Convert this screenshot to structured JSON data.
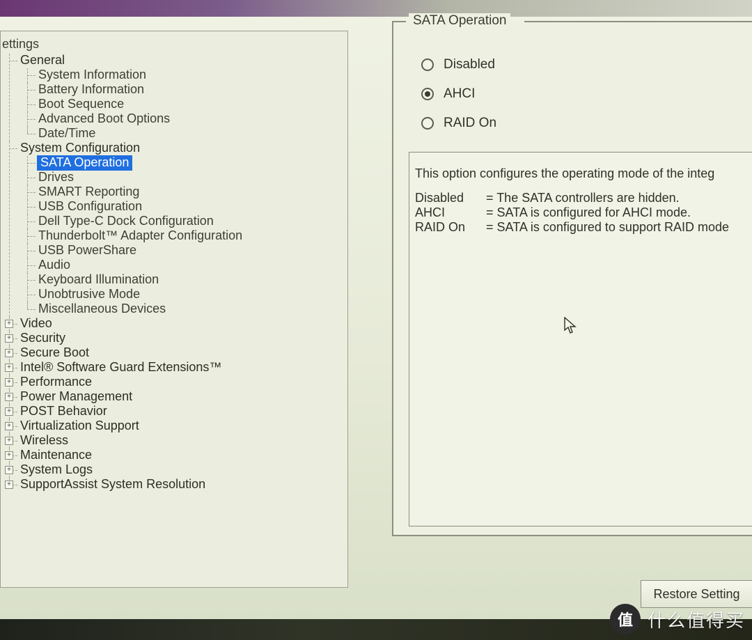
{
  "tree": {
    "title": "ettings",
    "groups": [
      {
        "label": "General",
        "expanded": true,
        "items": [
          "System Information",
          "Battery Information",
          "Boot Sequence",
          "Advanced Boot Options",
          "Date/Time"
        ]
      },
      {
        "label": "System Configuration",
        "expanded": true,
        "items": [
          "SATA Operation",
          "Drives",
          "SMART Reporting",
          "USB Configuration",
          "Dell Type-C Dock Configuration",
          "Thunderbolt™ Adapter Configuration",
          "USB PowerShare",
          "Audio",
          "Keyboard Illumination",
          "Unobtrusive Mode",
          "Miscellaneous Devices"
        ],
        "selected": "SATA Operation"
      },
      {
        "label": "Video",
        "expanded": false
      },
      {
        "label": "Security",
        "expanded": false
      },
      {
        "label": "Secure Boot",
        "expanded": false
      },
      {
        "label": "Intel® Software Guard Extensions™",
        "expanded": false
      },
      {
        "label": "Performance",
        "expanded": false
      },
      {
        "label": "Power Management",
        "expanded": false
      },
      {
        "label": "POST Behavior",
        "expanded": false
      },
      {
        "label": "Virtualization Support",
        "expanded": false
      },
      {
        "label": "Wireless",
        "expanded": false
      },
      {
        "label": "Maintenance",
        "expanded": false
      },
      {
        "label": "System Logs",
        "expanded": false
      },
      {
        "label": "SupportAssist System Resolution",
        "expanded": false
      }
    ]
  },
  "panel": {
    "legend": "SATA Operation",
    "options": [
      {
        "label": "Disabled",
        "checked": false
      },
      {
        "label": "AHCI",
        "checked": true
      },
      {
        "label": "RAID On",
        "checked": false
      }
    ],
    "description_main": "This option configures the operating mode of the integ",
    "description_rows": [
      {
        "key": "Disabled",
        "val": "= The SATA controllers are hidden."
      },
      {
        "key": "AHCI",
        "val": "= SATA is configured for AHCI mode."
      },
      {
        "key": "RAID On",
        "val": "= SATA is configured to support RAID mode"
      }
    ]
  },
  "buttons": {
    "restore": "Restore Setting"
  },
  "watermark": {
    "badge": "值",
    "text": "什么值得买"
  }
}
